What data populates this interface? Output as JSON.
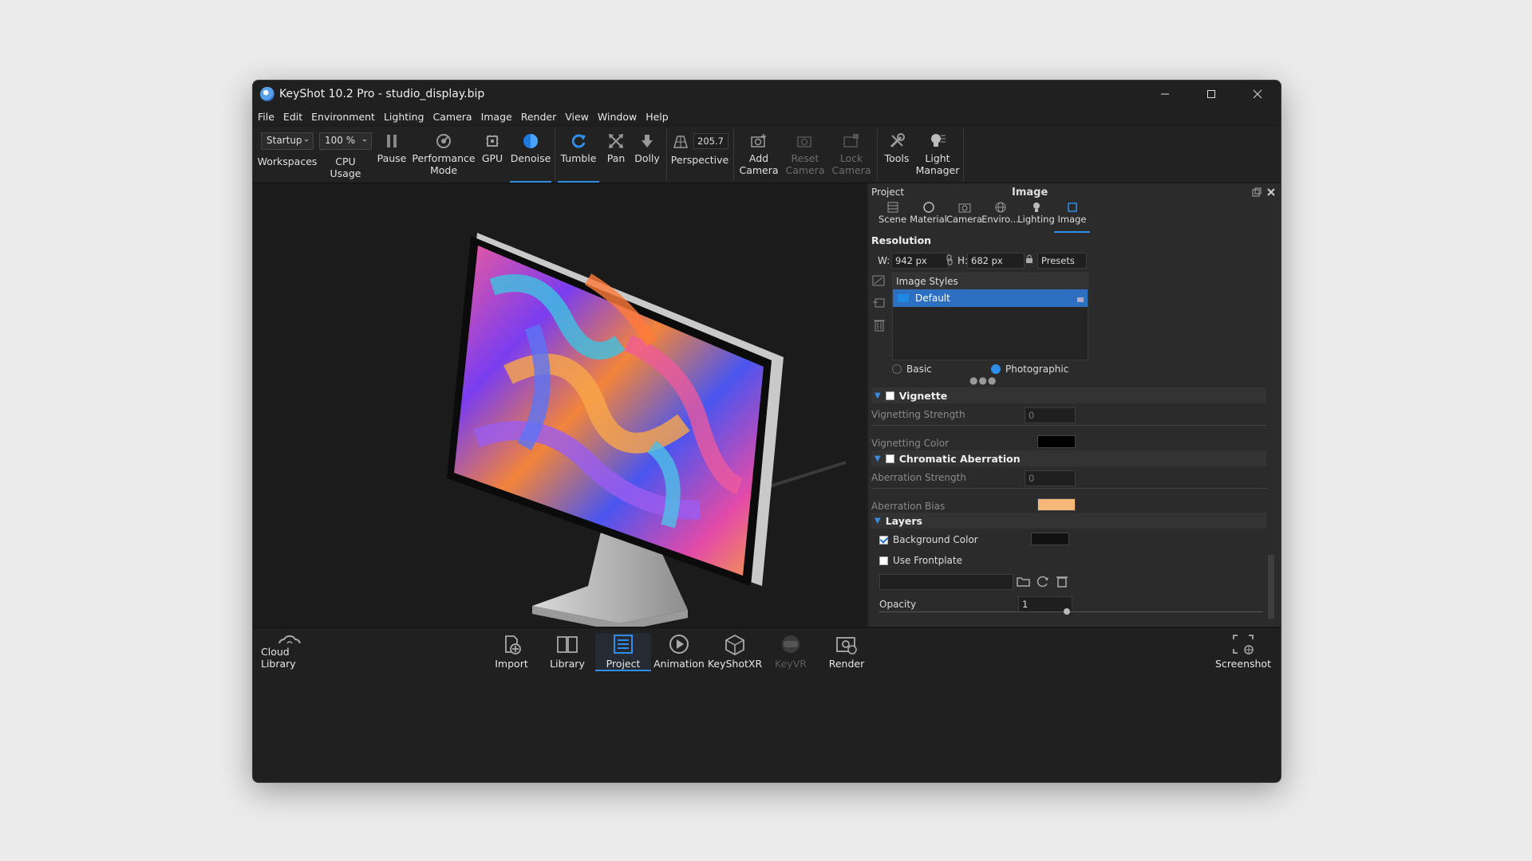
{
  "window": {
    "title": "KeyShot 10.2 Pro  - studio_display.bip"
  },
  "menu": [
    "File",
    "Edit",
    "Environment",
    "Lighting",
    "Camera",
    "Image",
    "Render",
    "View",
    "Window",
    "Help"
  ],
  "toolbar": {
    "workspace_value": "Startup",
    "workspaces_label": "Workspaces",
    "cpu_value": "100 %",
    "cpu_label": "CPU Usage",
    "pause_label": "Pause",
    "performance_label_1": "Performance",
    "performance_label_2": "Mode",
    "gpu_label": "GPU",
    "denoise_label": "Denoise",
    "tumble_label": "Tumble",
    "pan_label": "Pan",
    "dolly_label": "Dolly",
    "perspective_value": "205.7",
    "perspective_label": "Perspective",
    "add_camera_1": "Add",
    "add_camera_2": "Camera",
    "reset_camera_1": "Reset",
    "reset_camera_2": "Camera",
    "lock_camera_1": "Lock",
    "lock_camera_2": "Camera",
    "tools_label": "Tools",
    "light_manager_1": "Light",
    "light_manager_2": "Manager"
  },
  "panel": {
    "header_left": "Project",
    "header_title": "Image",
    "tabs": [
      "Scene",
      "Material",
      "Camera",
      "Enviro...",
      "Lighting",
      "Image"
    ],
    "resolution_title": "Resolution",
    "w_label": "W:",
    "w_value": "942 px",
    "h_label": "H:",
    "h_value": "682 px",
    "presets_label": "Presets",
    "image_styles_label": "Image Styles",
    "style_default": "Default",
    "mode_basic": "Basic",
    "mode_photographic": "Photographic",
    "vignette_title": "Vignette",
    "vignetting_strength_label": "Vignetting Strength",
    "vignetting_strength_value": "0",
    "vignetting_color_label": "Vignetting Color",
    "chromatic_title": "Chromatic Aberration",
    "aberration_strength_label": "Aberration Strength",
    "aberration_strength_value": "0",
    "aberration_bias_label": "Aberration Bias",
    "layers_title": "Layers",
    "background_color_label": "Background Color",
    "use_frontplate_label": "Use Frontplate",
    "opacity_label": "Opacity",
    "opacity_value": "1"
  },
  "colors": {
    "accent": "#2f8fe8",
    "vignetting_color": "#000000",
    "aberration_bias": "#f6b77b",
    "background_color": "#111111"
  },
  "bottom": {
    "cloud_library": "Cloud Library",
    "import": "Import",
    "library": "Library",
    "project": "Project",
    "animation": "Animation",
    "keyshotxr": "KeyShotXR",
    "keyvr": "KeyVR",
    "render": "Render",
    "screenshot": "Screenshot"
  }
}
